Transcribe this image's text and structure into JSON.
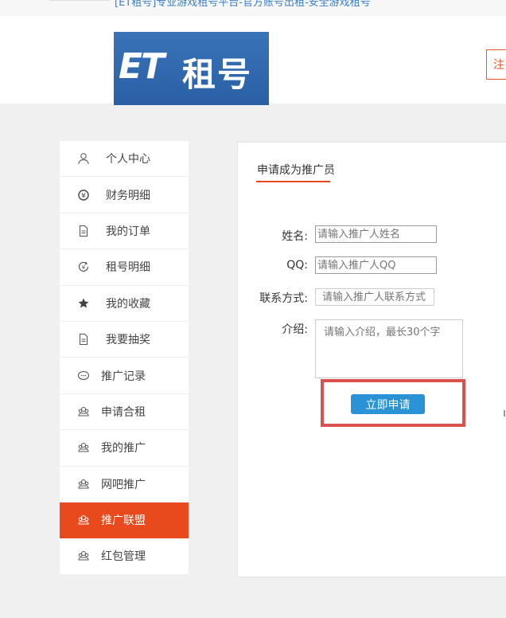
{
  "topbar": {
    "text": "[ET租号]专业游戏租号平台-官方账号出租-安全游戏租号"
  },
  "header": {
    "logo_latin": "ET",
    "logo_cn": "租号",
    "btn_text": "注"
  },
  "sidebar": {
    "items": [
      {
        "label": "个人中心",
        "icon": "user-icon"
      },
      {
        "label": "财务明细",
        "icon": "yen-icon"
      },
      {
        "label": "我的订单",
        "icon": "document-icon"
      },
      {
        "label": "租号明细",
        "icon": "refresh-coin-icon"
      },
      {
        "label": "我的收藏",
        "icon": "star-icon"
      },
      {
        "label": "我要抽奖",
        "icon": "document-icon"
      },
      {
        "label": "推广记录",
        "icon": "chat-icon"
      },
      {
        "label": "申请合租",
        "icon": "group-icon"
      },
      {
        "label": "我的推广",
        "icon": "group-icon"
      },
      {
        "label": "网吧推广",
        "icon": "group-icon"
      },
      {
        "label": "推广联盟",
        "icon": "group-icon",
        "active": true
      },
      {
        "label": "红包管理",
        "icon": "group-icon"
      }
    ]
  },
  "panel": {
    "title": "申请成为推广员",
    "form": {
      "name_label": "姓名:",
      "name_placeholder": "请输入推广人姓名",
      "qq_label": "QQ:",
      "qq_placeholder": "请输入推广人QQ",
      "contact_label": "联系方式:",
      "contact_placeholder": "请输入推广人联系方式",
      "intro_label": "介绍:",
      "intro_placeholder": "请输入介绍，最长30个字",
      "submit_label": "立即申请"
    }
  },
  "colors": {
    "accent": "#e8491d",
    "button": "#2a93d5",
    "highlight": "#d9524f",
    "logo_bg": "#2f68ad"
  }
}
